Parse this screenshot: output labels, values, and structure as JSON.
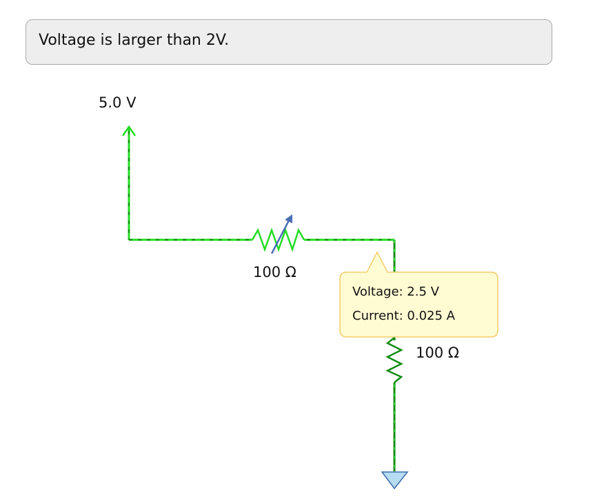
{
  "status": {
    "message": "Voltage is larger than 2V."
  },
  "source": {
    "voltage_label": "5.0 V"
  },
  "variable_resistor": {
    "label": "100 Ω"
  },
  "fixed_resistor": {
    "label": "100 Ω"
  },
  "tooltip": {
    "voltage": "Voltage: 2.5 V",
    "current": "Current: 0.025 A"
  },
  "colors": {
    "wire_bright": "#22dd22",
    "wire_dark": "#128c12",
    "arrow_blue": "#4a6fb5",
    "ground_fill": "#b5dcf0",
    "ground_stroke": "#3c6aa8",
    "tooltip_bg": "#fffbd2",
    "tooltip_border": "#f2cd6a"
  }
}
